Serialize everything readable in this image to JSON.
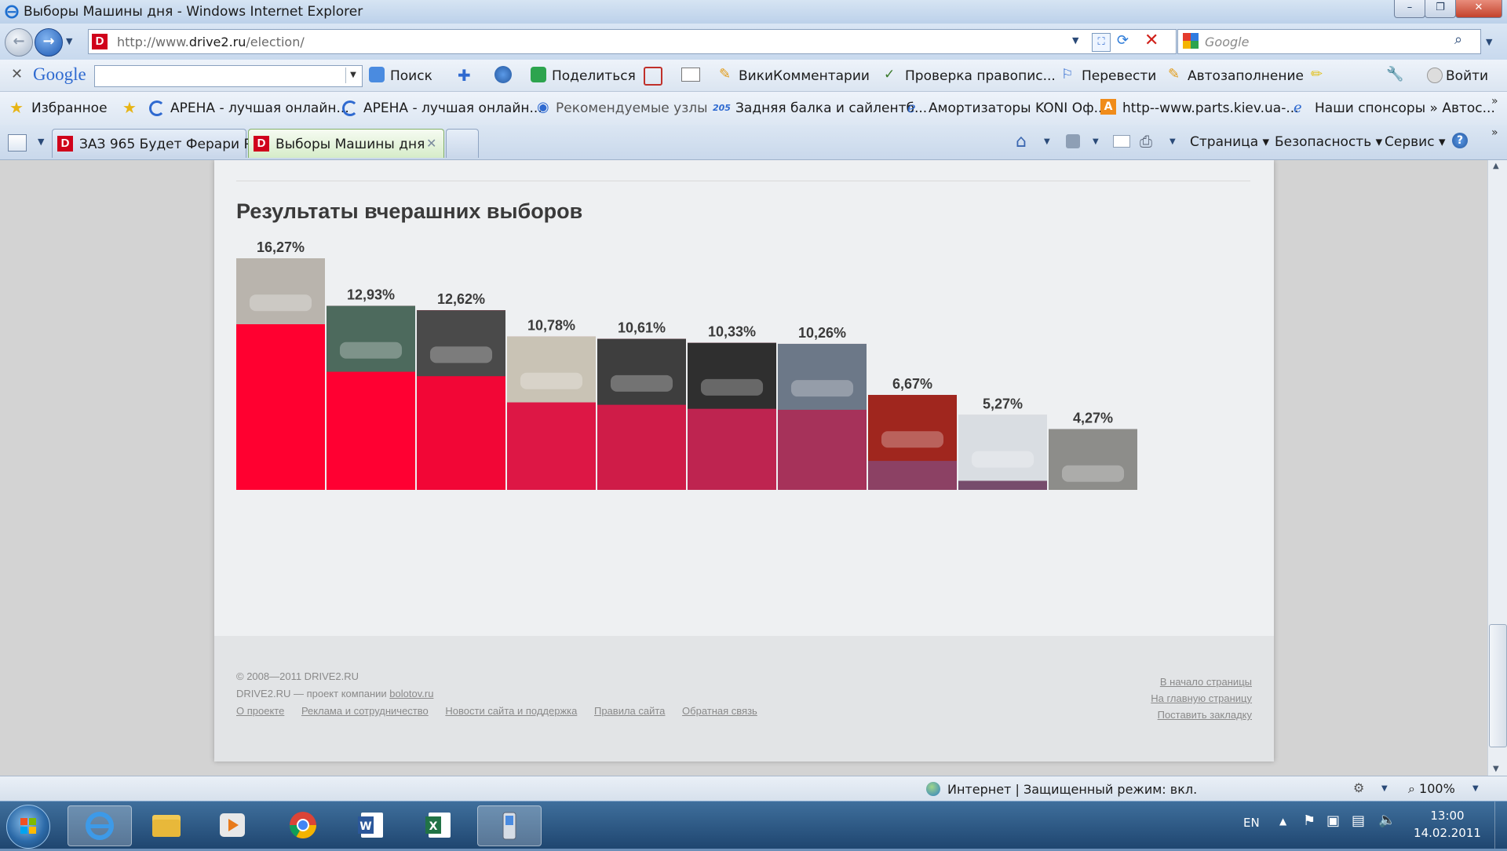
{
  "window": {
    "title": "Выборы Машины дня - Windows Internet Explorer"
  },
  "address": {
    "url_prefix": "http://www.",
    "url_domain": "drive2.ru",
    "url_suffix": "/election/",
    "search_placeholder": "Google"
  },
  "google_toolbar": {
    "logo": "Google",
    "items": [
      "Поиск",
      "Поделиться",
      "ВикиКомментарии",
      "Проверка правопис...",
      "Перевести",
      "Автозаполнение",
      "Войти"
    ]
  },
  "favorites": {
    "label": "Избранное",
    "items": [
      "АРЕНА - лучшая онлайн...",
      "АРЕНА - лучшая онлайн...",
      "Рекомендуемые узлы",
      "Задняя балка и сайлентб...",
      "Амортизаторы KONI Оф...",
      "http--www.parts.kiev.ua-...",
      "Наши спонсоры » Автос..."
    ],
    "badge_205": "205"
  },
  "tabs": [
    {
      "label": "ЗАЗ 965 Будет Ферари Ре..."
    },
    {
      "label": "Выборы Машины дня"
    }
  ],
  "command_bar": {
    "page": "Страница",
    "safety": "Безопасность",
    "tools": "Сервис"
  },
  "page": {
    "heading": "Результаты вчерашних выборов",
    "footer": {
      "copyright": "© 2008—2011 DRIVE2.RU",
      "project_prefix": "DRIVE2.RU — проект компании ",
      "project_link": "bolotov.ru",
      "links": [
        "О проекте",
        "Реклама и сотрудничество",
        "Новости сайта и поддержка",
        "Правила сайта",
        "Обратная связь"
      ],
      "right_links": [
        "В начало страницы",
        "На главную страницу",
        "Поставить закладку"
      ]
    }
  },
  "chart_data": {
    "type": "bar",
    "labels": [
      "16,27%",
      "12,93%",
      "12,62%",
      "10,78%",
      "10,61%",
      "10,33%",
      "10,26%",
      "6,67%",
      "5,27%",
      "4,27%"
    ],
    "values": [
      16.27,
      12.93,
      12.62,
      10.78,
      10.61,
      10.33,
      10.26,
      6.67,
      5.27,
      4.27
    ],
    "colors": [
      "#ff0030",
      "#ff0032",
      "#f20636",
      "#dd1745",
      "#cf1c48",
      "#be2450",
      "#a6325a",
      "#8c4164",
      "#764c6c",
      "#5e5978"
    ],
    "thumb_colors": [
      "#b9b4ad",
      "#4d6a5d",
      "#4a4a4a",
      "#c9c3b5",
      "#3e3e3e",
      "#2f2f2f",
      "#6c7888",
      "#a0261e",
      "#d9dde2",
      "#8d8d8a"
    ]
  },
  "status_bar": {
    "zone": "Интернет | Защищенный режим: вкл.",
    "zoom": "100%"
  },
  "taskbar": {
    "lang": "EN",
    "time": "13:00",
    "date": "14.02.2011"
  }
}
